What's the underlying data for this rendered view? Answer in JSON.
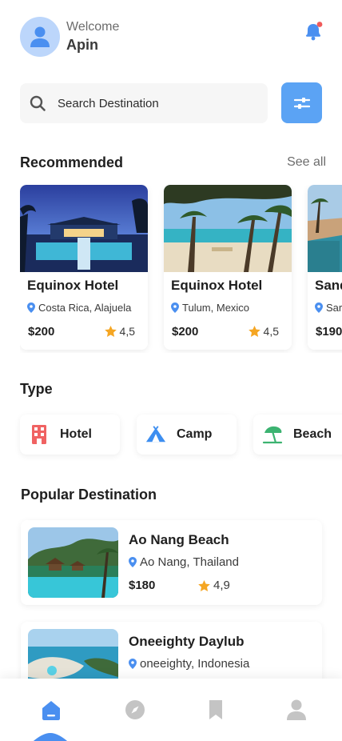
{
  "header": {
    "welcome_label": "Welcome",
    "user_name": "Apin"
  },
  "search": {
    "placeholder": "Search Destination"
  },
  "recommended": {
    "title": "Recommended",
    "see_all": "See all",
    "cards": [
      {
        "name": "Equinox  Hotel",
        "location": "Costa Rica, Alajuela",
        "price": "$200",
        "rating": "4,5"
      },
      {
        "name": "Equinox  Hotel",
        "location": "Tulum, Mexico",
        "price": "$200",
        "rating": "4,5"
      },
      {
        "name": "Sand",
        "location": "Sar",
        "price": "$190",
        "rating": ""
      }
    ]
  },
  "types": {
    "title": "Type",
    "items": [
      {
        "label": "Hotel",
        "icon": "hotel-icon"
      },
      {
        "label": "Camp",
        "icon": "tent-icon"
      },
      {
        "label": "Beach",
        "icon": "umbrella-icon"
      }
    ]
  },
  "popular": {
    "title": "Popular Destination",
    "items": [
      {
        "name": "Ao Nang Beach",
        "location": "Ao Nang, Thailand",
        "price": "$180",
        "rating": "4,9"
      },
      {
        "name": "Oneeighty Daylub",
        "location": "oneeighty, Indonesia",
        "price": "",
        "rating": ""
      }
    ]
  },
  "nav": {
    "items": [
      "home-icon",
      "compass-icon",
      "bookmark-icon",
      "profile-icon"
    ]
  },
  "colors": {
    "accent": "#5ba3f4",
    "star": "#f5a623",
    "hotel": "#f06262",
    "camp": "#3d8ef0",
    "beach": "#3cb371"
  }
}
